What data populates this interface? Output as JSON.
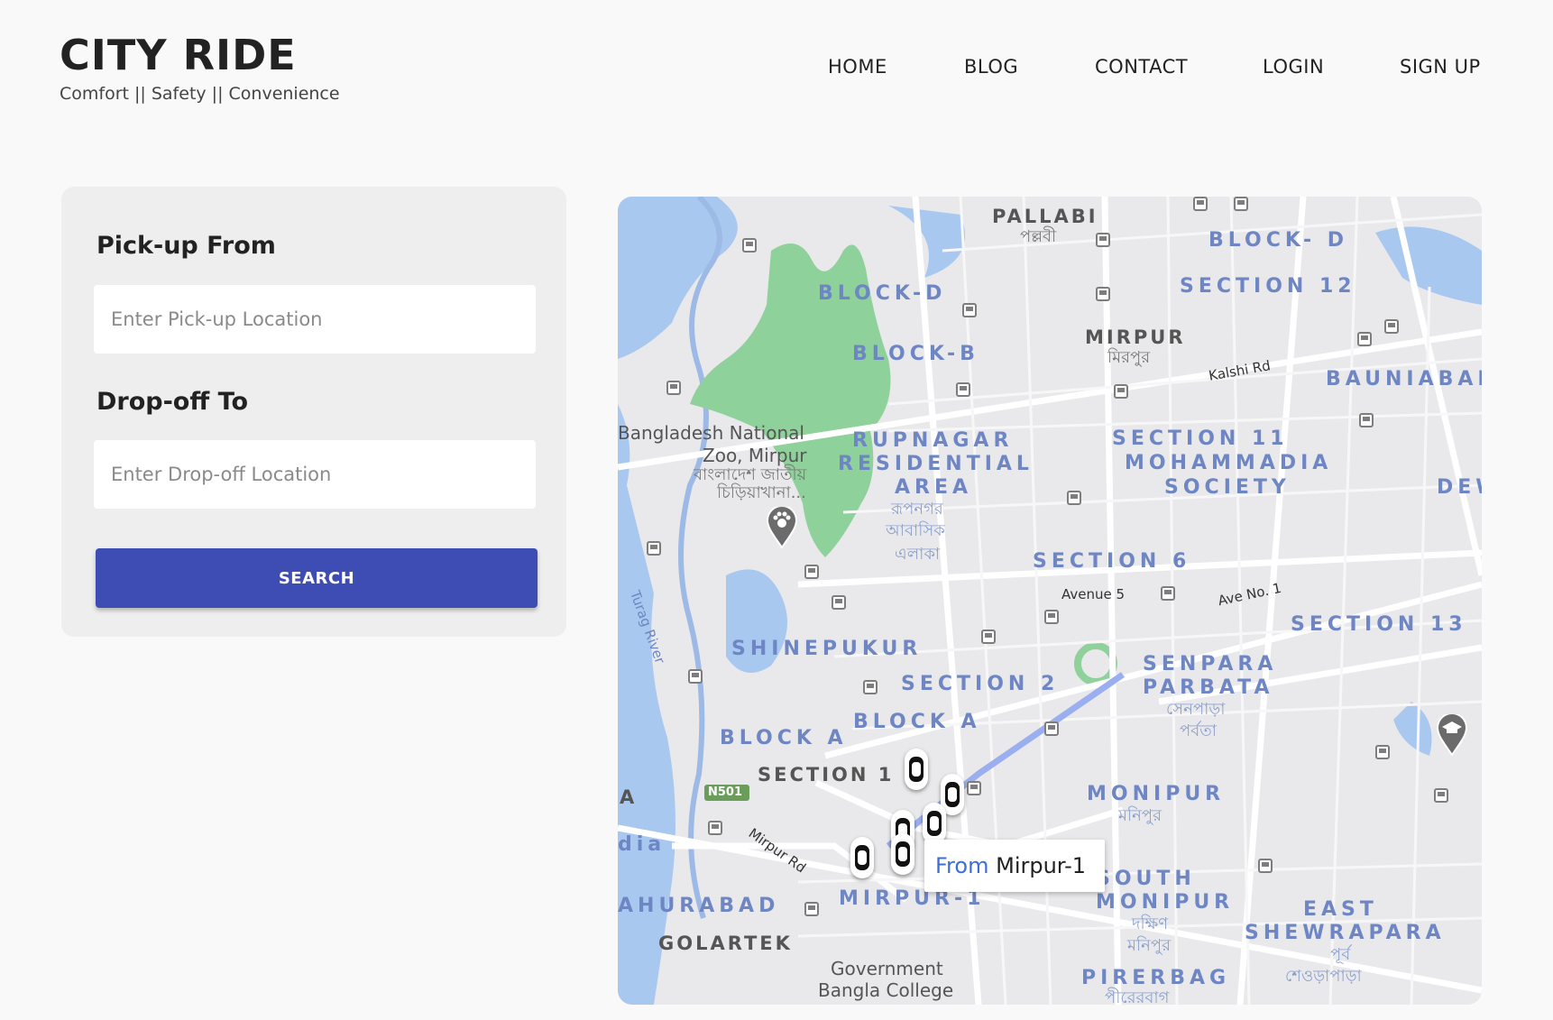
{
  "brand": {
    "title": "CITY RIDE",
    "tagline": "Comfort || Safety || Convenience"
  },
  "nav": {
    "home": "HOME",
    "blog": "BLOG",
    "contact": "CONTACT",
    "login": "LOGIN",
    "signup": "SIGN UP"
  },
  "form": {
    "pickup_label": "Pick-up From",
    "pickup_placeholder": "Enter Pick-up Location",
    "pickup_value": "",
    "dropoff_label": "Drop-off To",
    "dropoff_placeholder": "Enter Drop-off Location",
    "dropoff_value": "",
    "search_label": "SEARCH"
  },
  "map": {
    "tooltip": {
      "prefix": "From",
      "place": "Mirpur-1"
    },
    "labels": {
      "pallabi": "PALLABI",
      "pallabi_bn": "পল্লবী",
      "block_d_top": "BLOCK- D",
      "section_12": "SECTION 12",
      "block_d": "BLOCK-D",
      "block_b": "BLOCK-B",
      "mirpur": "MIRPUR",
      "mirpur_bn": "মিরপুর",
      "kalshi_rd": "Kalshi Rd",
      "bauniabad": "BAUNIABAD",
      "zoo_1": "Bangladesh National",
      "zoo_2": "Zoo, Mirpur",
      "zoo_bn_1": "বাংলাদেশ জাতীয়",
      "zoo_bn_2": "চিড়িয়াখানা...",
      "rupnagar_1": "RUPNAGAR",
      "rupnagar_2": "RESIDENTIAL",
      "rupnagar_3": "AREA",
      "rupnagar_bn_1": "রূপনগর",
      "rupnagar_bn_2": "আবাসিক",
      "rupnagar_bn_3": "এলাকা",
      "section_11": "SECTION 11",
      "mohammadia_1": "MOHAMMADIA",
      "mohammadia_2": "SOCIETY",
      "dew": "DEW",
      "section_6": "SECTION 6",
      "avenue_5": "Avenue 5",
      "ave_no_1": "Ave No. 1",
      "section_13": "SECTION 13",
      "turag_river": "Turag River",
      "shinepukur": "SHINEPUKUR",
      "section_2": "SECTION 2",
      "senpara_1": "SENPARA",
      "senpara_2": "PARBATA",
      "senpara_bn_1": "সেনপাড়া",
      "senpara_bn_2": "পর্বতা",
      "block_a_left": "BLOCK A",
      "block_a_mid": "BLOCK A",
      "section_1": "SECTION 1",
      "n501": "N501",
      "monipur": "MONIPUR",
      "monipur_bn": "মনিপুর",
      "mirpur_rd": "Mirpur Rd",
      "dia": "dia",
      "a": "A",
      "south_monipur_1": "SOUTH",
      "south_monipur_2": "MONIPUR",
      "south_monipur_bn_1": "দক্ষিণ",
      "south_monipur_bn_2": "মনিপুর",
      "east_shewrapara_1": "EAST",
      "east_shewrapara_2": "SHEWRAPARA",
      "east_shewrapara_bn_1": "পূর্ব",
      "east_shewrapara_bn_2": "শেওড়াপাড়া",
      "ahurabad": "AHURABAD",
      "mirpur_1": "MIRPUR-1",
      "golartek": "GOLARTEK",
      "govt_college_1": "Government",
      "govt_college_2": "Bangla College",
      "pirerbag": "PIRERBAG",
      "pirerbag_bn": "পীরেরবাগ"
    }
  }
}
